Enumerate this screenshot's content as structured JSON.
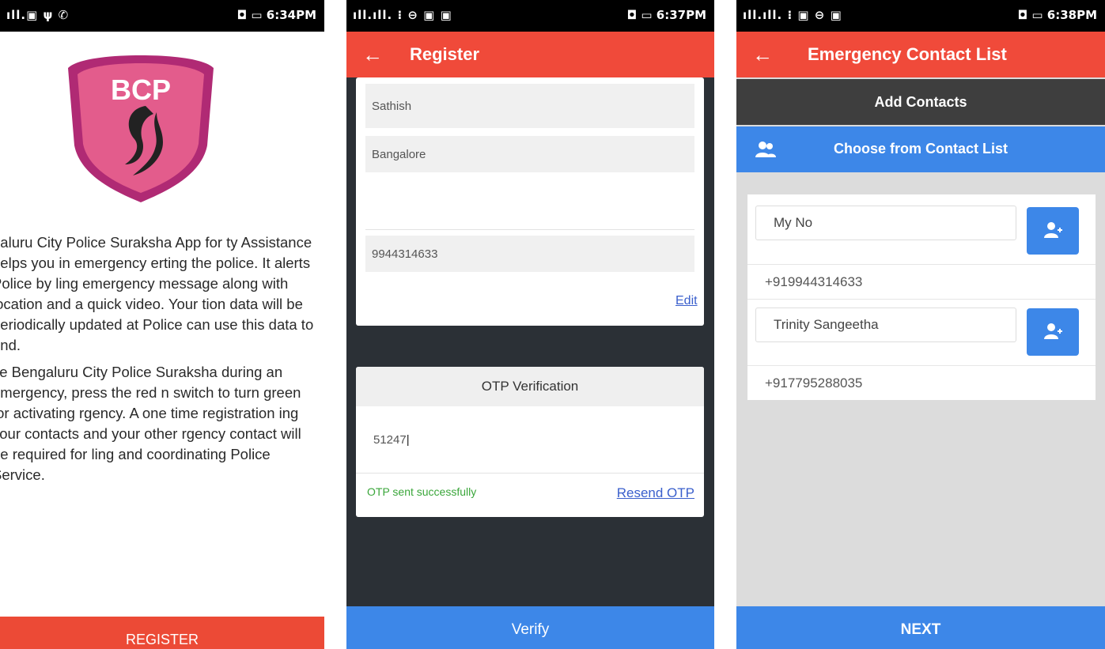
{
  "screen1": {
    "status_left": "ıll.▣ ψ ✆",
    "status_right": "◘ ▭ 6:34PM",
    "logo_text": "BCP",
    "paragraph1": "galuru City Police Suraksha App for ty Assistance helps you in emergency erting the police. It alerts Police by ling emergency message along with location and a quick video. Your tion data will be periodically updated at Police can use this data to ond.",
    "paragraph2": "se Bengaluru City Police Suraksha during an emergency, press the red n switch to turn green for activating rgency. A one time registration ing your contacts and your other rgency contact will be required for ling and coordinating Police Service.",
    "register_label": "REGISTER"
  },
  "screen2": {
    "status_left": "ıll.ıll. ⁝ ⊖ ▣ ▣",
    "status_right": "◘ ▭ 6:37PM",
    "title": "Register",
    "fields": {
      "name": "Sathish",
      "city": "Bangalore",
      "phone": "9944314633"
    },
    "edit_label": "Edit",
    "otp_title": "OTP Verification",
    "otp_value": "51247",
    "otp_status": "OTP sent successfully",
    "resend_label": "Resend OTP",
    "verify_label": "Verify"
  },
  "screen3": {
    "status_left": "ıll.ıll. ⁝ ▣ ⊖ ▣",
    "status_right": "◘ ▭ 6:38PM",
    "title": "Emergency Contact List",
    "add_contacts_label": "Add Contacts",
    "choose_label": "Choose from Contact List",
    "contacts": [
      {
        "name": "My No",
        "phone": "+919944314633"
      },
      {
        "name": "Trinity Sangeetha",
        "phone": "+917795288035"
      }
    ],
    "next_label": "NEXT"
  },
  "colors": {
    "app_bar": "#f04a3a",
    "primary_blue": "#3d87e8",
    "dark_background": "#2b3036",
    "logo_pink": "#e35c8c",
    "success_green": "#3aa63a"
  }
}
